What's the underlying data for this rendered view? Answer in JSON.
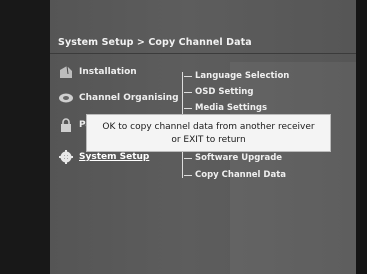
{
  "header": {
    "breadcrumb": "System Setup > Copy Channel Data"
  },
  "menu": {
    "items": [
      {
        "label": "Installation",
        "icon": "satellite-dish-icon"
      },
      {
        "label": "Channel Organising",
        "icon": "tv-icon"
      },
      {
        "label": "Pa",
        "icon": "lock-icon"
      },
      {
        "label": "System Setup",
        "icon": "gear-icon"
      }
    ],
    "selected": "System Setup"
  },
  "submenu": {
    "items": [
      "Language Selection",
      "OSD Setting",
      "Media Settings",
      "Software Upgrade",
      "Copy Channel Data"
    ]
  },
  "dialog": {
    "line1": "OK to copy channel data from another receiver",
    "line2": "or EXIT to return"
  }
}
